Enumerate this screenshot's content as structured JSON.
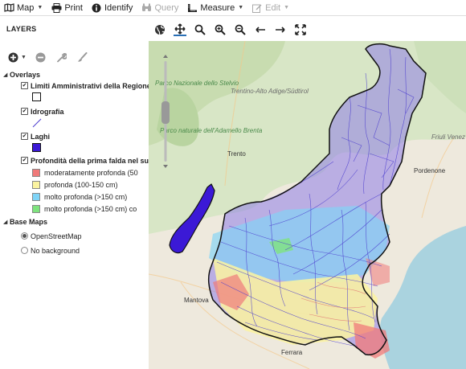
{
  "toolbar": {
    "map_label": "Map",
    "print_label": "Print",
    "identify_label": "Identify",
    "query_label": "Query",
    "measure_label": "Measure",
    "edit_label": "Edit"
  },
  "panel": {
    "title": "LAYERS",
    "overlays_label": "Overlays",
    "base_maps_label": "Base Maps",
    "layers": [
      {
        "label": "Limiti Amministrativi della Regione"
      },
      {
        "label": "Idrografia"
      },
      {
        "label": "Laghi"
      },
      {
        "label": "Profondità della prima falda nel suc"
      }
    ],
    "legend_items": [
      {
        "label": "moderatamente profonda (50",
        "color": "#f07a7a"
      },
      {
        "label": "profonda (100-150 cm)",
        "color": "#fbf3a0"
      },
      {
        "label": "molto profonda (>150 cm)",
        "color": "#7fd4f7"
      },
      {
        "label": "molto profonda (>150 cm) co",
        "color": "#7ee37e"
      }
    ],
    "base_maps": [
      {
        "label": "OpenStreetMap",
        "selected": true
      },
      {
        "label": "No background",
        "selected": false
      }
    ]
  },
  "map": {
    "labels": {
      "parco_stelvio": "Parco Nazionale dello Stelvio",
      "trentino": "Trentino-Alto Adige/Südtirol",
      "parco_adamello": "Parco naturale dell'Adamello Brenta",
      "trento": "Trento",
      "friuli": "Friuli Venez Giulia",
      "pordenone": "Pordenone",
      "mantova": "Mantova",
      "ferrara": "Ferrara"
    }
  },
  "colors": {
    "hydro": "#4b3ccf",
    "region_border": "#111111",
    "lake": "#3b19d6",
    "accent": "#2a6fb5"
  }
}
